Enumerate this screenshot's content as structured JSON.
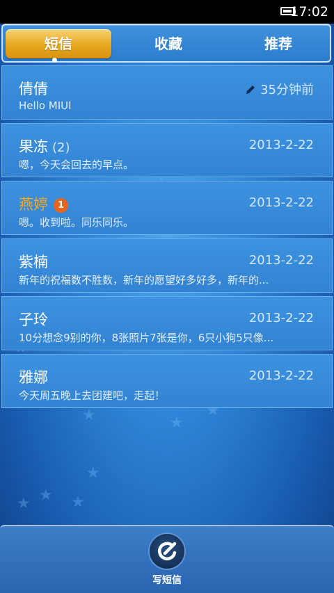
{
  "status_bar": {
    "time": "17:02"
  },
  "tabs": [
    {
      "label": "短信",
      "active": true
    },
    {
      "label": "收藏",
      "active": false
    },
    {
      "label": "推荐",
      "active": false
    }
  ],
  "messages": [
    {
      "name": "倩倩",
      "count": "",
      "badge": "",
      "time": "35分钟前",
      "preview": "Hello MIUI",
      "unread": false,
      "draft": true
    },
    {
      "name": "果冻",
      "count": "(2)",
      "badge": "",
      "time": "2013-2-22",
      "preview": "嗯，今天会回去的早点。",
      "unread": false,
      "draft": false
    },
    {
      "name": "燕婷",
      "count": "",
      "badge": "1",
      "time": "2013-2-22",
      "preview": "嗯。收到啦。同乐同乐。",
      "unread": true,
      "draft": false
    },
    {
      "name": "紫楠",
      "count": "",
      "badge": "",
      "time": "2013-2-22",
      "preview": "新年的祝福数不胜数，新年的愿望好多好多，新年的...",
      "unread": false,
      "draft": false
    },
    {
      "name": "子玲",
      "count": "",
      "badge": "",
      "time": "2013-2-22",
      "preview": "10分想念9别的你，8张照片7张是你，6只小狗5只像...",
      "unread": false,
      "draft": false
    },
    {
      "name": "雅娜",
      "count": "",
      "badge": "",
      "time": "2013-2-22",
      "preview": "今天周五晚上去团建吧，走起！",
      "unread": false,
      "draft": false
    }
  ],
  "bottom_bar": {
    "compose_label": "写短信",
    "compose_icon": "compose-icon"
  },
  "colors": {
    "active_tab": "#e7a81f",
    "unread_name": "#f5a623",
    "badge": "#e8641b"
  }
}
